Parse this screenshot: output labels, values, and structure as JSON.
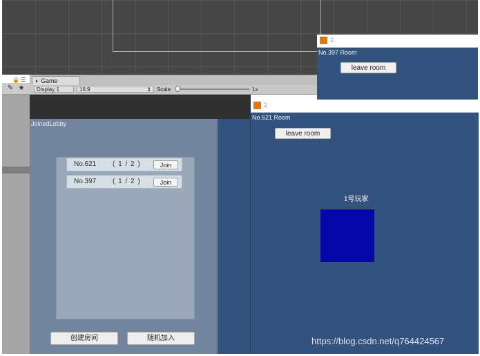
{
  "left_panel": {
    "lock": "🔒",
    "menu": "☰",
    "tag_icon": "✎",
    "star_icon": "★"
  },
  "game_view": {
    "tab_label": "Game",
    "display": "Display 1",
    "aspect": "16:9",
    "scale_label": "Scale",
    "scale_value": "1x"
  },
  "lobby": {
    "title": "JoinedLobby",
    "rooms": [
      {
        "name": "No.621",
        "count": "( 1 / 2 )",
        "join_label": "Join"
      },
      {
        "name": "No.397",
        "count": "( 1 / 2 )",
        "join_label": "Join"
      }
    ],
    "create_button": "创建房间",
    "random_join_button": "随机加入"
  },
  "window_back": {
    "number": "2",
    "room": "No.397 Room",
    "leave_label": "leave room"
  },
  "window_front": {
    "number": "2",
    "room": "No.621 Room",
    "leave_label": "leave room",
    "player_label": "1号玩家"
  },
  "colors": {
    "player_box": "#0505a8",
    "window_bg": "#33527d",
    "lobby_bg": "#73849f",
    "icon": "#e07a10"
  },
  "watermark": "https://blog.csdn.net/q764424567"
}
